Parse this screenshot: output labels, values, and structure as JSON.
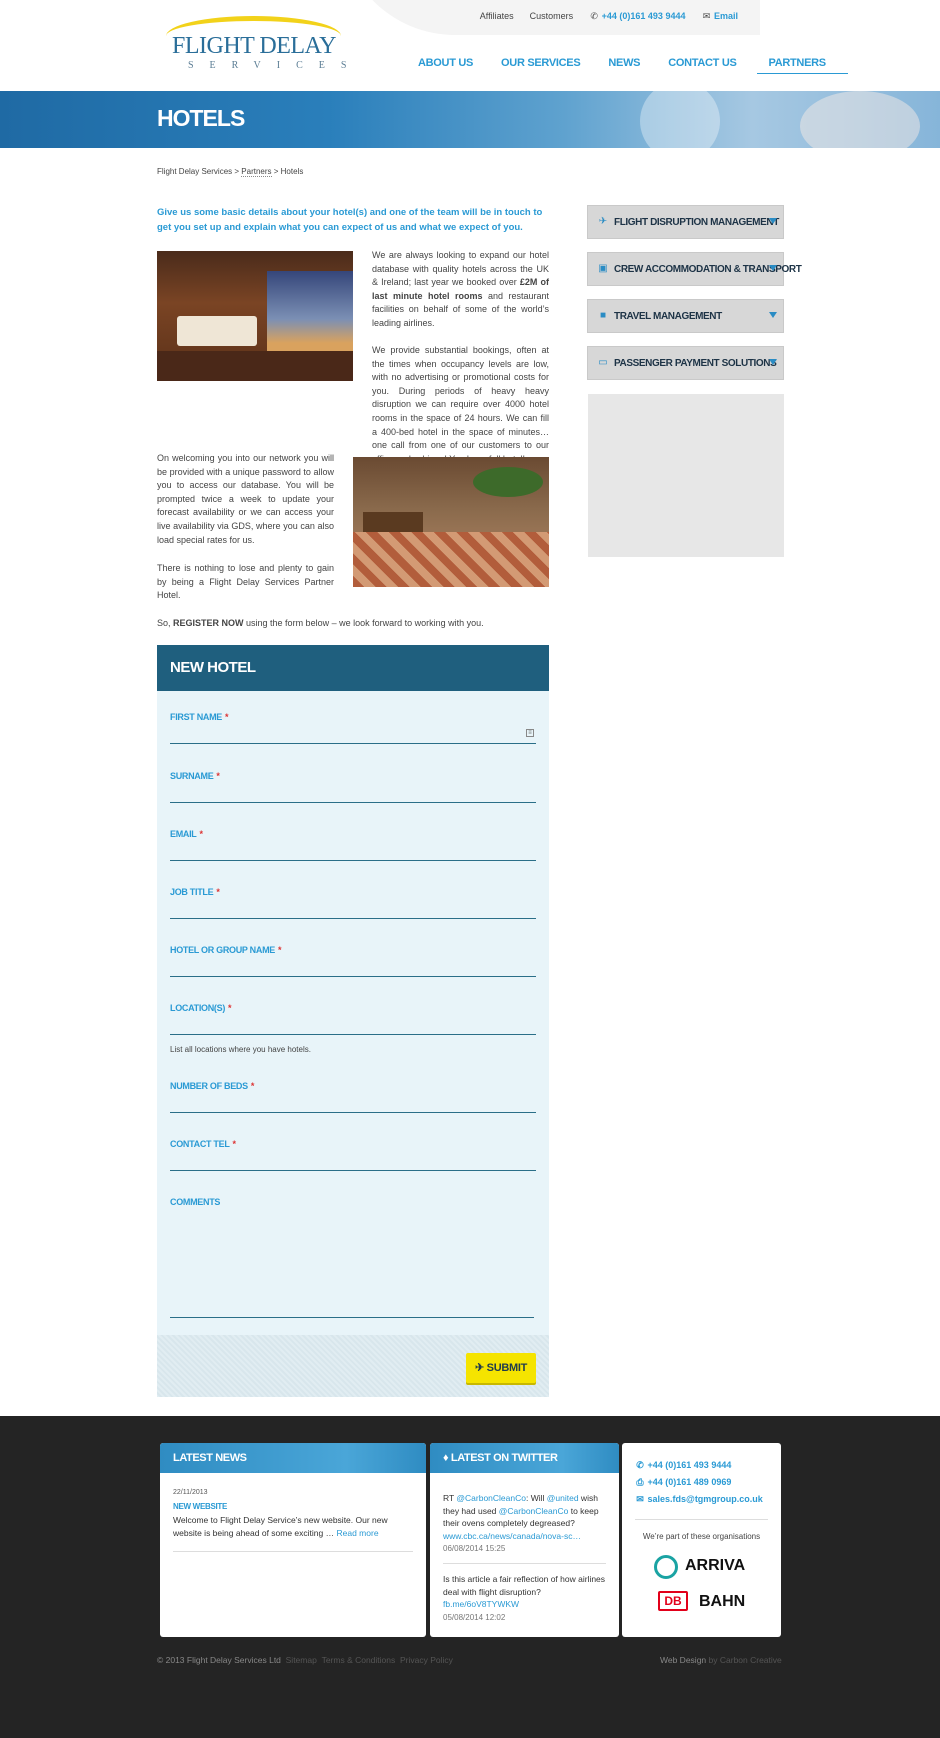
{
  "header": {
    "logo_name": "FLIGHT DELAY",
    "logo_sub": "SERVICES",
    "util": {
      "affiliates": "Affiliates",
      "customers": "Customers",
      "phone": "+44 (0)161 493 9444",
      "email": "Email"
    },
    "nav": [
      "ABOUT US",
      "OUR SERVICES",
      "NEWS",
      "CONTACT US",
      "PARTNERS"
    ]
  },
  "banner": {
    "title": "HOTELS"
  },
  "breadcrumb": {
    "root": "Flight Delay Services",
    "sep": ">",
    "mid": "Partners",
    "current": "Hotels"
  },
  "content": {
    "intro": "Give us some basic details about your hotel(s) and one of the team will be in touch to get you set up and explain what you can expect of us and what we expect of you.",
    "p1a": "We are always looking to expand our hotel database with quality hotels across the UK & Ireland; last year we booked over ",
    "p1b": "£2M of last minute hotel rooms",
    "p1c": " and restaurant facilities on behalf of some of the world’s leading airlines.",
    "p2": "We provide substantial bookings, often at the times when occupancy levels are low, with no advertising or promotional costs for you. During periods of heavy heavy disruption we can require over 4000 hotel rooms in the space of 24 hours. We can fill a 400-bed hotel in the space of minutes…one call from one of our customers to our office and….bingo! You have full hotel!",
    "p3": "On welcoming you into our network you will be provided with a unique password to allow you to access our database. You will be prompted twice a week to update your forecast availability or we can access your live availability via GDS, where you can also load special rates for us.",
    "p4": "There is nothing to lose and plenty to gain by being a Flight Delay Services Partner Hotel.",
    "p5a": "So, ",
    "p5b": "REGISTER NOW",
    "p5c": " using the form below – we look forward to working with you."
  },
  "form": {
    "title": "NEW HOTEL",
    "required": "*",
    "fields": {
      "first_name": "FIRST NAME",
      "surname": "SURNAME",
      "email": "EMAIL",
      "job_title": "JOB TITLE",
      "hotel": "HOTEL OR GROUP NAME",
      "locations": "LOCATION(S)",
      "locations_hint": "List all locations where you have hotels.",
      "beds": "NUMBER OF BEDS",
      "tel": "CONTACT TEL",
      "comments": "COMMENTS"
    },
    "submit": "SUBMIT"
  },
  "sidebar": [
    {
      "label": "FLIGHT DISRUPTION MANAGEMENT",
      "icon": "plane-icon"
    },
    {
      "label": "CREW ACCOMMODATION & TRANSPORT",
      "icon": "bus-icon"
    },
    {
      "label": "TRAVEL MANAGEMENT",
      "icon": "suitcase-icon"
    },
    {
      "label": "PASSENGER PAYMENT SOLUTIONS",
      "icon": "card-icon"
    }
  ],
  "footer": {
    "news": {
      "title": "LATEST NEWS",
      "date": "22/11/2013",
      "headline": "NEW WEBSITE",
      "text": "Welcome to Flight Delay Service’s new website. Our new website is being ahead of some exciting …",
      "more": "Read more"
    },
    "twitter": {
      "title": "LATEST ON TWITTER",
      "t1_rt": "RT ",
      "t1_h1": "@CarbonCleanCo",
      "t1_a": ": Will ",
      "t1_h2": "@united",
      "t1_b": " wish they had used ",
      "t1_h3": "@CarbonCleanCo",
      "t1_c": " to keep their ovens completely degreased?",
      "t1_link": "www.cbc.ca/news/canada/nova-sc…",
      "t1_date": "06/08/2014 15:25",
      "t2_text": "Is this article a fair reflection of how airlines deal with flight disruption?",
      "t2_link": "fb.me/6oV8TYWKW",
      "t2_date": "05/08/2014 12:02"
    },
    "contact": {
      "phone": "+44 (0)161 493 9444",
      "fax": "+44 (0)161 489 0969",
      "email": "sales.fds@tgmgroup.co.uk",
      "orgs": "We’re part of these organisations",
      "arriva": "ARRIVA",
      "db": "DB",
      "bahn": "BAHN"
    },
    "legal": {
      "copy": "© 2013 Flight Delay Services Ltd",
      "sitemap": "Sitemap",
      "terms": "Terms & Conditions",
      "privacy": "Privacy Policy",
      "webdesign": "Web Design",
      "by": "by Carbon Creative"
    }
  }
}
